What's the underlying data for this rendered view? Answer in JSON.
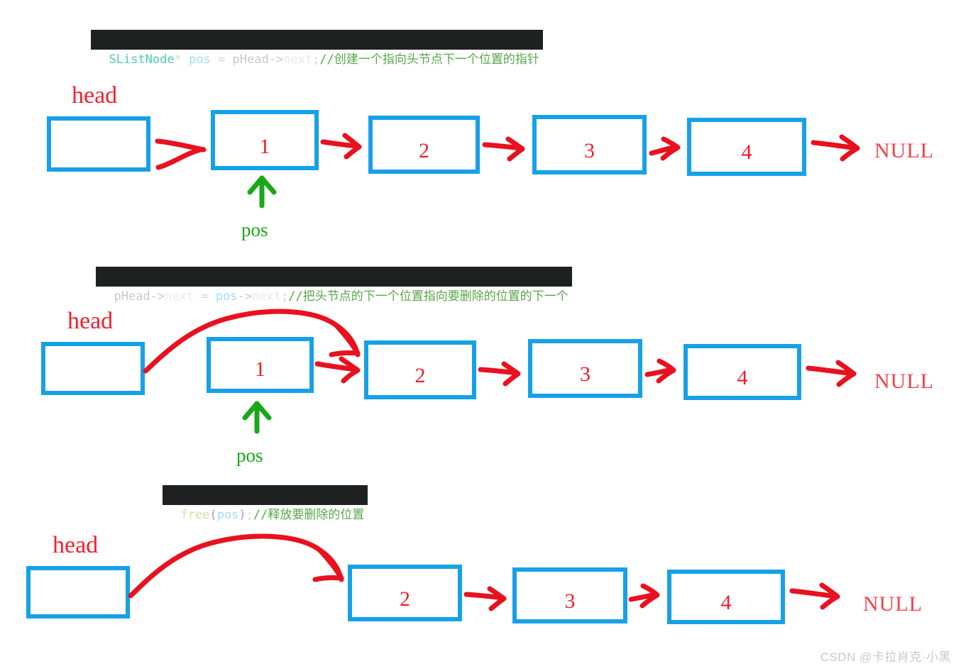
{
  "page": {
    "background": "#ffffff",
    "node_border_color": "#16a1e7",
    "arrow_color": "#e8111f",
    "text_red": "#ef1c2a",
    "text_green": "#18a818"
  },
  "watermark": {
    "text": "CSDN @卡拉肖克·小黑"
  },
  "steps": [
    {
      "id": "step-1",
      "code": {
        "type": "SListNode",
        "star": "*",
        "space1": " ",
        "var": "pos",
        "assign": " = ",
        "obj": "pHead",
        "arrow": "->",
        "member": "next",
        "semi": ";",
        "comment": "//创建一个指向头节点下一个位置的指针",
        "full_text": "SListNode* pos = pHead->next;//创建一个指向头节点下一个位置的指针"
      },
      "head_label": "head",
      "nodes": [
        "",
        "1",
        "2",
        "3",
        "4"
      ],
      "terminator": "NULL",
      "pointer_label": "pos"
    },
    {
      "id": "step-2",
      "code": {
        "obj": "pHead",
        "arrow": "->",
        "member": "next",
        "assign": " = ",
        "var": "pos",
        "arrow2": "->",
        "member2": "next",
        "semi": ";",
        "comment": "//把头节点的下一个位置指向要删除的位置的下一个",
        "full_text": "pHead->next = pos->next;//把头节点的下一个位置指向要删除的位置的下一个"
      },
      "head_label": "head",
      "nodes": [
        "",
        "1",
        "2",
        "3",
        "4"
      ],
      "terminator": "NULL",
      "pointer_label": "pos"
    },
    {
      "id": "step-3",
      "code": {
        "fn": "free",
        "lparen": "(",
        "var": "pos",
        "rparen": ")",
        "semi": ";",
        "comment": "//释放要删除的位置",
        "full_text": "free(pos);//释放要删除的位置"
      },
      "head_label": "head",
      "nodes": [
        "",
        "2",
        "3",
        "4"
      ],
      "terminator": "NULL"
    }
  ]
}
